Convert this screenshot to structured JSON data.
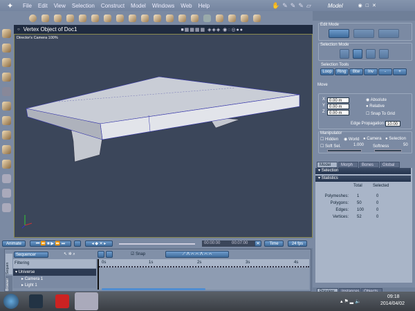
{
  "menu": {
    "items": [
      "File",
      "Edit",
      "View",
      "Selection",
      "Construct",
      "Model",
      "Windows",
      "Web",
      "Help"
    ],
    "room": "Model"
  },
  "viewport": {
    "title": "Vertex Object of Doc1",
    "camera": "Director's Camera 100%"
  },
  "edit_mode": {
    "label": "Edit Mode"
  },
  "selection_mode": {
    "label": "Selection Mode"
  },
  "selection_tools": {
    "label": "Selection Tools",
    "buttons": [
      "Loop",
      "Ring",
      "Btw",
      "Inv",
      "-",
      "+"
    ]
  },
  "move": {
    "label": "Move",
    "x": "0.00 m",
    "y": "0.00 m",
    "z": "0.00 m",
    "x_label": "X",
    "y_label": "Y",
    "z_label": "Z",
    "absolute": "Absolute",
    "relative": "Relative",
    "snap_to_grid": "Snap To Grid",
    "edge_prop_label": "Edge Propagation",
    "edge_prop_value": "10.00",
    "selected_mode": "Relative"
  },
  "manipulator": {
    "label": "Manipulator",
    "hidden": "Hidden",
    "world": "World",
    "camera": "Camera",
    "selection": "Selection",
    "soft_sel": "Soft Sel.",
    "soft_sel_value": "1.000",
    "softness": "Softness",
    "softness_value": "50"
  },
  "tabs": [
    "Model",
    "Morph",
    "Bones",
    "Global"
  ],
  "sections": {
    "selection": "Selection",
    "statistics": "Statistics"
  },
  "stats": {
    "headers": [
      "Total",
      "Selected"
    ],
    "rows": [
      {
        "label": "Polymeshes:",
        "total": "1",
        "selected": "0"
      },
      {
        "label": "Polygons:",
        "total": "50",
        "selected": "0"
      },
      {
        "label": "Edges:",
        "total": "100",
        "selected": "0"
      },
      {
        "label": "Vertices:",
        "total": "52",
        "selected": "0"
      }
    ]
  },
  "bottom_tabs": [
    "Preview",
    "Instances",
    "Objects"
  ],
  "anim": {
    "animate": "Animate",
    "time_start": "00:00:00",
    "time_end": "00:07:00",
    "time_mode": "Time",
    "fps": "24 fps"
  },
  "sequencer": {
    "mode": "Sequencer",
    "filtering": "Filtering",
    "snap": "Snap",
    "side_tabs": [
      "Sequen",
      "Browser"
    ],
    "tree": [
      "Universe",
      "Camera 1",
      "Light 1"
    ],
    "ticks": [
      "0s",
      "1s",
      "2s",
      "3s",
      "4s"
    ]
  },
  "taskbar": {
    "time": "09:18",
    "date": "2014/04/02"
  },
  "colors": {
    "accent": "#3f6c9c",
    "viewport_bg": "#3b465a",
    "panel": "#7b8aa3"
  }
}
